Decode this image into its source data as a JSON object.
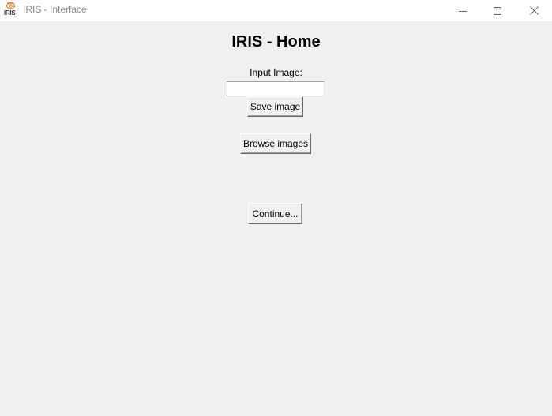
{
  "window": {
    "title": "IRIS - Interface",
    "icon": "iris-logo-icon",
    "icon_text": "IRIS",
    "controls": {
      "minimize": "minimize-icon",
      "maximize": "maximize-icon",
      "close": "close-icon"
    }
  },
  "main": {
    "heading": "IRIS - Home",
    "input_label": "Input Image:",
    "input_value": "",
    "save_label": "Save image",
    "browse_label": "Browse images",
    "continue_label": "Continue..."
  },
  "colors": {
    "background": "#f0f0f0",
    "titlebar": "#ffffff",
    "logo_accent": "#e8741e"
  }
}
